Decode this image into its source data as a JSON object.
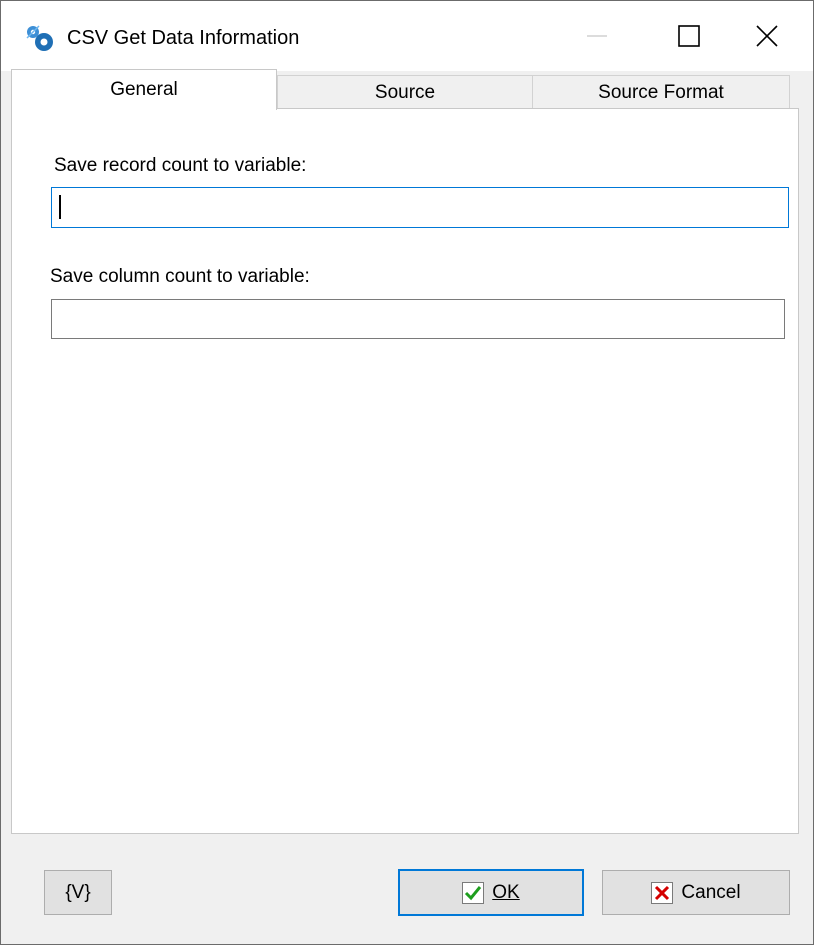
{
  "window": {
    "title": "CSV Get Data Information",
    "app_icon": "gears-icon"
  },
  "titlebar": {
    "minimize_icon": "minimize-icon",
    "maximize_icon": "maximize-icon",
    "close_icon": "close-icon"
  },
  "tabs": [
    {
      "label": "General",
      "selected": true
    },
    {
      "label": "Source",
      "selected": false
    },
    {
      "label": "Source Format",
      "selected": false
    }
  ],
  "general": {
    "record_count_label": "Save record count to variable:",
    "record_count_value": "",
    "column_count_label": "Save column count to variable:",
    "column_count_value": ""
  },
  "buttons": {
    "variables_label": "{V}",
    "ok_label": "OK",
    "cancel_label": "Cancel",
    "ok_icon": "checkmark-icon",
    "cancel_icon": "x-mark-icon"
  },
  "colors": {
    "focus_accent": "#0078d7",
    "ok_check": "#1e9e1e",
    "cancel_x": "#d40000"
  }
}
